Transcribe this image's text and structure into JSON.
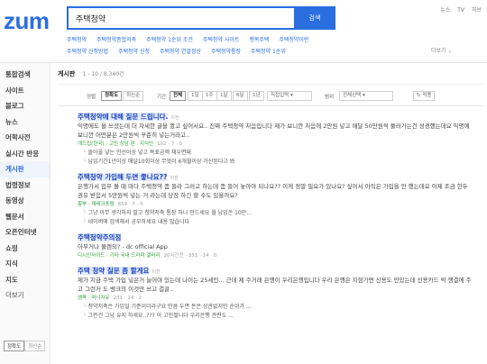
{
  "header": {
    "logo": "zum",
    "search_value": "주택청약",
    "search_button": "검색",
    "top_links": [
      "뉴스",
      "TV",
      "허브"
    ],
    "suggestions": [
      "주택청약",
      "주택청약종합저축",
      "주택청약 1순위 조건",
      "주택청약 사이트",
      "행복주택",
      "주택청약이란",
      "주택청약 신청방법",
      "주택청약 신청",
      "주택청약 연말정산",
      "주택청약통장",
      "주택청약 1순위"
    ],
    "more": "더보기"
  },
  "sidebar": {
    "items": [
      "통합검색",
      "사이트",
      "블로그",
      "뉴스",
      "어학사전",
      "실시간 반응",
      "게시판",
      "법령정보",
      "동영상",
      "웹문서",
      "오픈인터넷",
      "쇼핑",
      "지식",
      "지도",
      "더보기"
    ],
    "toggle": [
      "정확도",
      "최신순"
    ]
  },
  "results": {
    "section_title": "게시판",
    "count": "1 - 10 / 8,340건",
    "sort_label": "정렬",
    "sort": [
      "정확도",
      "최신순"
    ],
    "period_label": "기간",
    "periods": [
      "전체",
      "1일",
      "1주",
      "1달",
      "6달",
      "1년"
    ],
    "period_custom": "직접입력",
    "scope_label": "범위",
    "scope": "전체선택",
    "apply": "적용"
  },
  "items": [
    {
      "title": "주택청약에 대해 질문 드립니다.",
      "tag": "이전",
      "snippet": "익명에도 올 쓰셨는데 더 자세한 글을 봤고 싶어서요.. 진짜 주택청약 처음입니다 제가 보니깐 처음에 2만원 넣고 매달 50만원씩 둘러가는건 성경했는데요 익명에 보니깐 어떤분은 2만원씩 꾸준히 넣는거라고..",
      "meta": "개드립(한국) · 고민 상담 판 · 지식인",
      "stats": "102 · 7 · 0",
      "subs": [
        "돌아올 넣는 인선이상 넣고 목표금액 채우면돼",
        "납입기간1년이상 매달10회이상 무엇이 6개월이상 가산된다고 봐"
      ]
    },
    {
      "title": "주택청약 가입해 두면 좋나요??",
      "tag": "이전",
      "snippet": "은행가서 업무 볼 때 마다 주택청약 좀 들라 그러고 하는데 좀 들어 놓아야 되나요?? 이게 정말 필요가 있나요? 싶어서 아직은 가입을 안 했는데요 이제 조금 한두 권유 받음서 5만원씩 넣는 거 라는데 당장 하긴 할 수도 있을까요?",
      "meta": "뽐뿌 · 재테크포럼",
      "stats": "659 · 7 · 0",
      "subs": [
        "그냥 아무 생각하지 말고 청약저축 통장 하나 만드세요 월 납입은 10만...",
        "네이버에 검색해서 공부하세요 내용 많습니다"
      ]
    },
    {
      "title": "주택청약주의점",
      "tag": "",
      "snippet": "아무거나 물렌되? - dc official App",
      "meta": "디시인사이드 · 기타 국내 드라마 갤러리",
      "stats": "20시간전 · 351 · 14 · 0",
      "subs": []
    },
    {
      "title": "주택 청약 질문 좀 할게요",
      "tag": "이전",
      "snippet": "제가 지금 주택 가입 넣은거 늘어야 있는데 나이는 25세인... 근데 제 주거래 은행이 우리은행입니다 우리 은행은 지점가면 신용도 만있는데 신용카드 막 행결에 주고 그런거 도 뱅크의 이것만 쓰고 결골..",
      "meta": "엠팍 · 머니자유",
      "stats": "231 · 14 · 2",
      "subs": [
        "청약저축은 가입일 기준이더라구요 만큼 두면 돈은 상관없지만 순위가 ...",
        "그런건 그냥 유지 하세요..??? 아 고민필니다 우리은행 관련도 ..."
      ]
    }
  ]
}
